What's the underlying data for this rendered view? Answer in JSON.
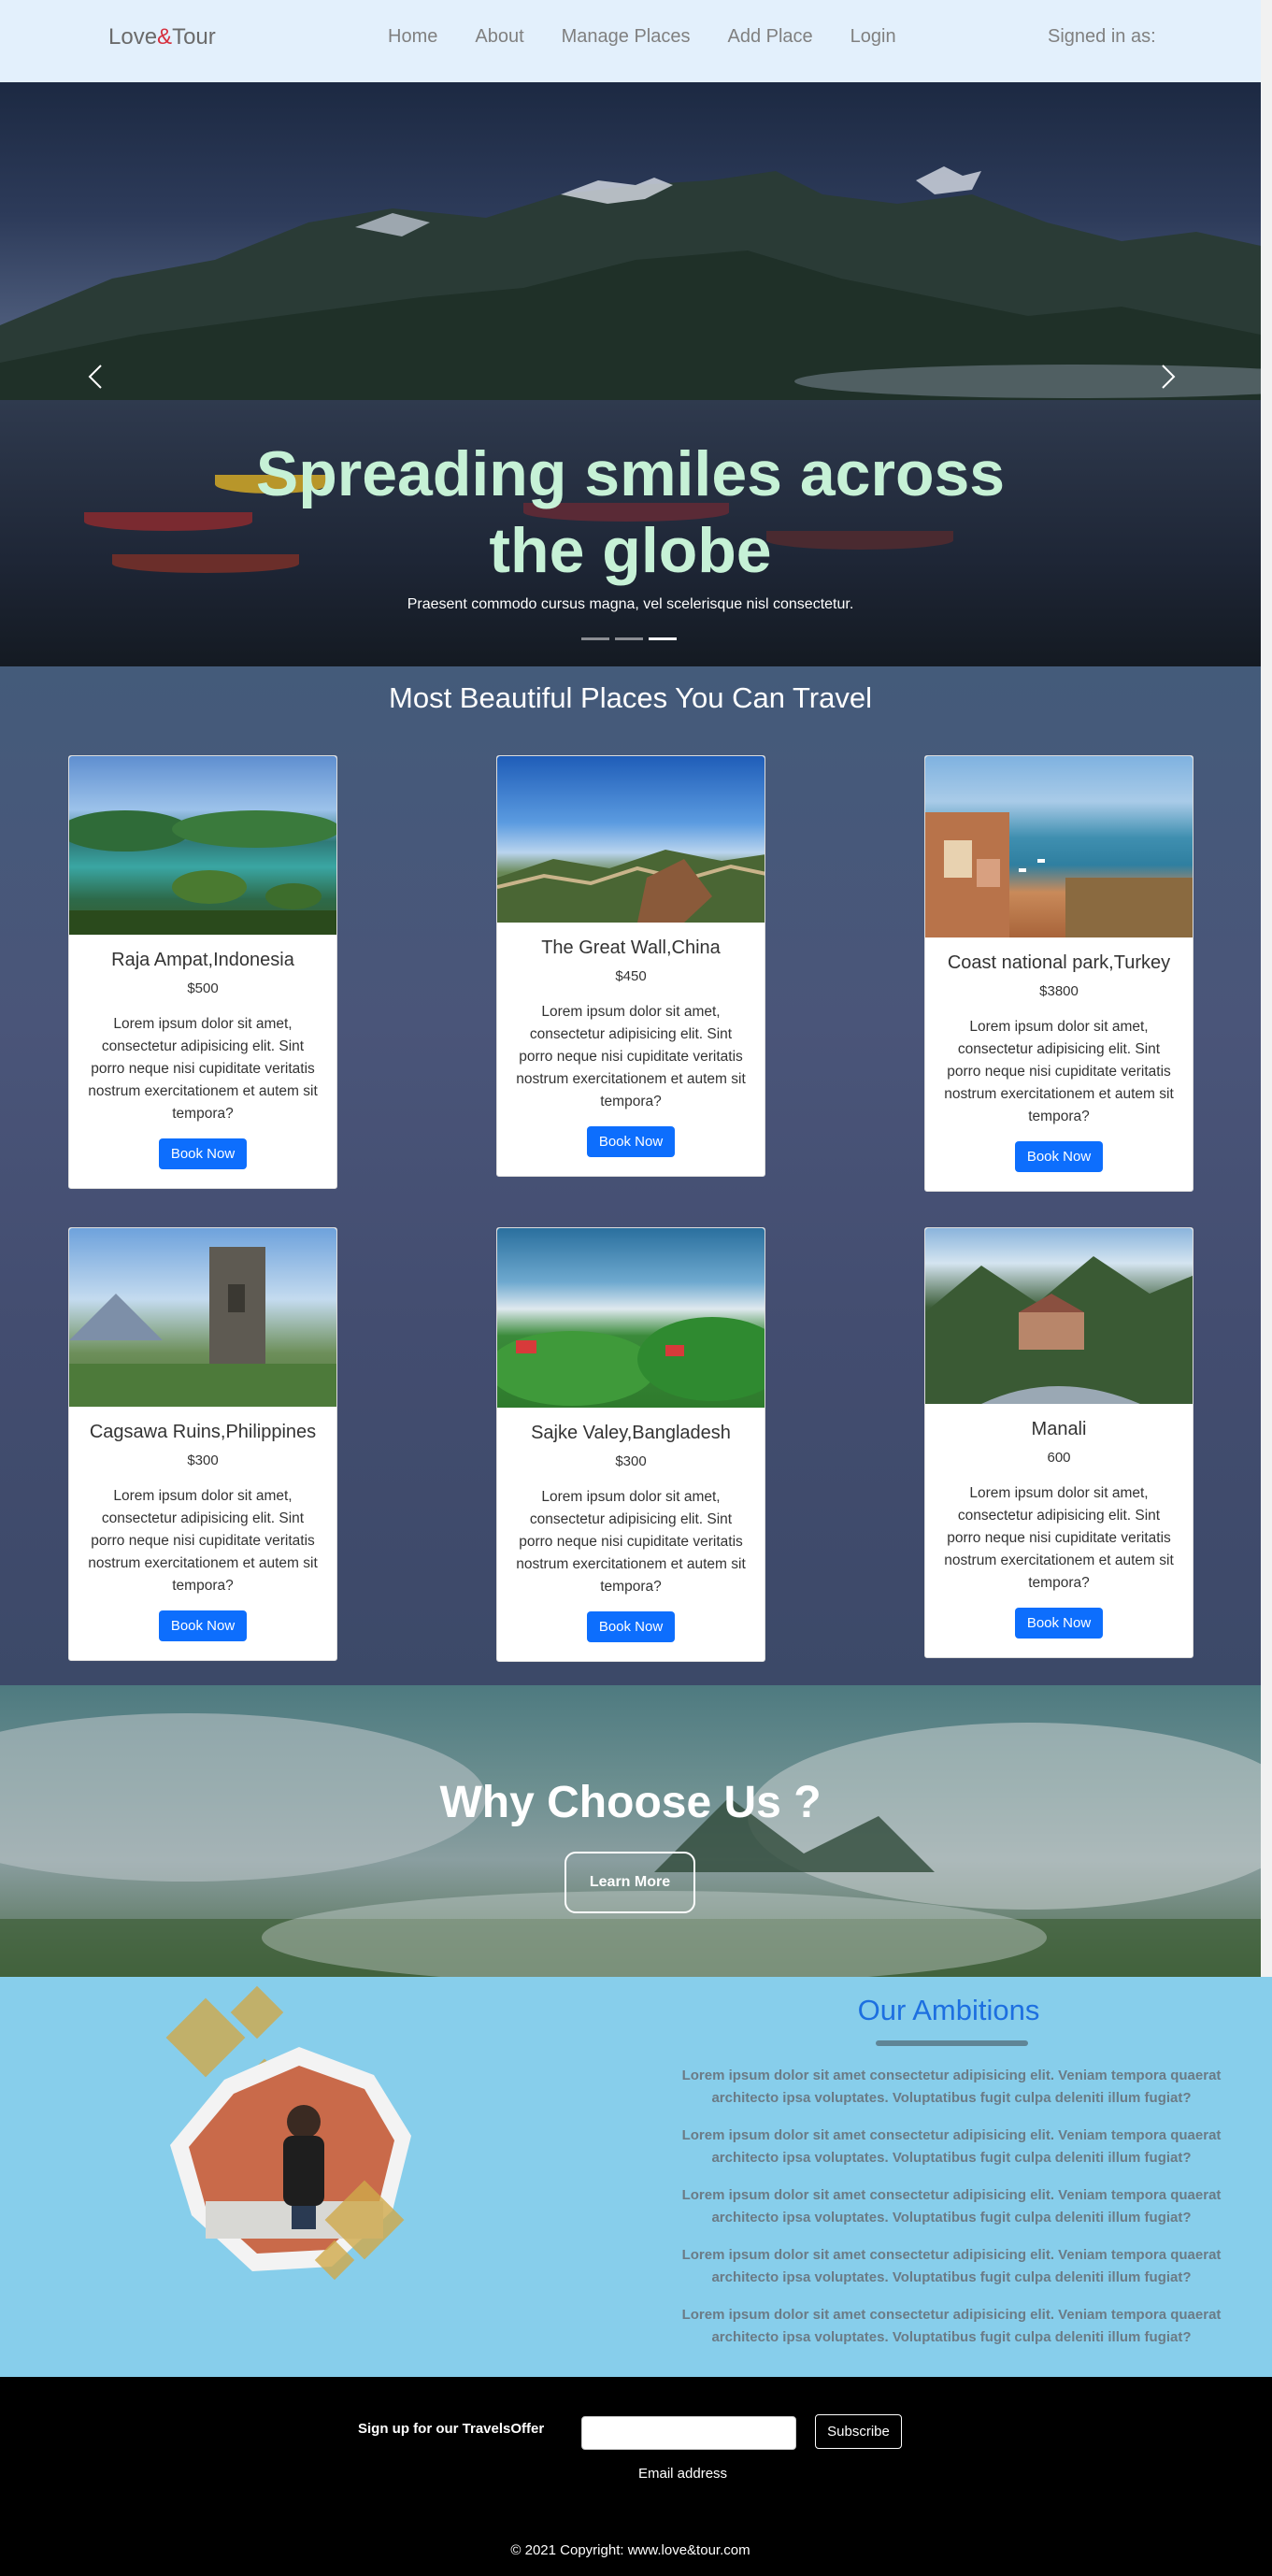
{
  "navbar": {
    "brand_part1": "Love",
    "brand_amp": "&",
    "brand_part2": "Tour",
    "links": [
      "Home",
      "About",
      "Manage Places",
      "Add Place",
      "Login"
    ],
    "signed_in": "Signed in as:"
  },
  "hero": {
    "title": "Spreading smiles across the globe",
    "caption": "Praesent commodo cursus magna, vel scelerisque nisl consectetur.",
    "prev_icon": "chevron-left-icon",
    "next_icon": "chevron-right-icon",
    "active_slide": 3,
    "slide_count": 3
  },
  "places": {
    "title": "Most Beautiful Places You Can Travel",
    "book_label": "Book Now",
    "description": "Lorem ipsum dolor sit amet, consectetur adipisicing elit. Sint porro neque nisi cupiditate veritatis nostrum exercitationem et autem sit tempora?",
    "cards": [
      {
        "name": "Raja Ampat,Indonesia",
        "price": "$500"
      },
      {
        "name": "The Great Wall,China",
        "price": "$450"
      },
      {
        "name": "Coast national park,Turkey",
        "price": "$3800"
      },
      {
        "name": "Cagsawa Ruins,Philippines",
        "price": "$300"
      },
      {
        "name": "Sajke Valey,Bangladesh",
        "price": "$300"
      },
      {
        "name": "Manali",
        "price": "600"
      }
    ]
  },
  "why": {
    "title": "Why Choose Us ?",
    "button": "Learn More"
  },
  "ambitions": {
    "title": "Our Ambitions",
    "items": [
      "Lorem ipsum dolor sit amet consectetur adipisicing elit. Veniam tempora quaerat architecto ipsa voluptates. Voluptatibus fugit culpa deleniti illum fugiat?",
      "Lorem ipsum dolor sit amet consectetur adipisicing elit. Veniam tempora quaerat architecto ipsa voluptates. Voluptatibus fugit culpa deleniti illum fugiat?",
      "Lorem ipsum dolor sit amet consectetur adipisicing elit. Veniam tempora quaerat architecto ipsa voluptates. Voluptatibus fugit culpa deleniti illum fugiat?",
      "Lorem ipsum dolor sit amet consectetur adipisicing elit. Veniam tempora quaerat architecto ipsa voluptates. Voluptatibus fugit culpa deleniti illum fugiat?",
      "Lorem ipsum dolor sit amet consectetur adipisicing elit. Veniam tempora quaerat architecto ipsa voluptates. Voluptatibus fugit culpa deleniti illum fugiat?"
    ]
  },
  "footer": {
    "signup_label": "Sign up for our TravelsOffer",
    "subscribe": "Subscribe",
    "email_hint": "Email address",
    "copyright": "© 2021 Copyright: www.love&tour.com"
  },
  "colors": {
    "navbar_bg": "#e3f0fc",
    "hero_title": "#c6f1d6",
    "book_button": "#0d6efd",
    "ambitions_bg": "#87ceeb",
    "ambitions_title": "#1d6fe0"
  }
}
